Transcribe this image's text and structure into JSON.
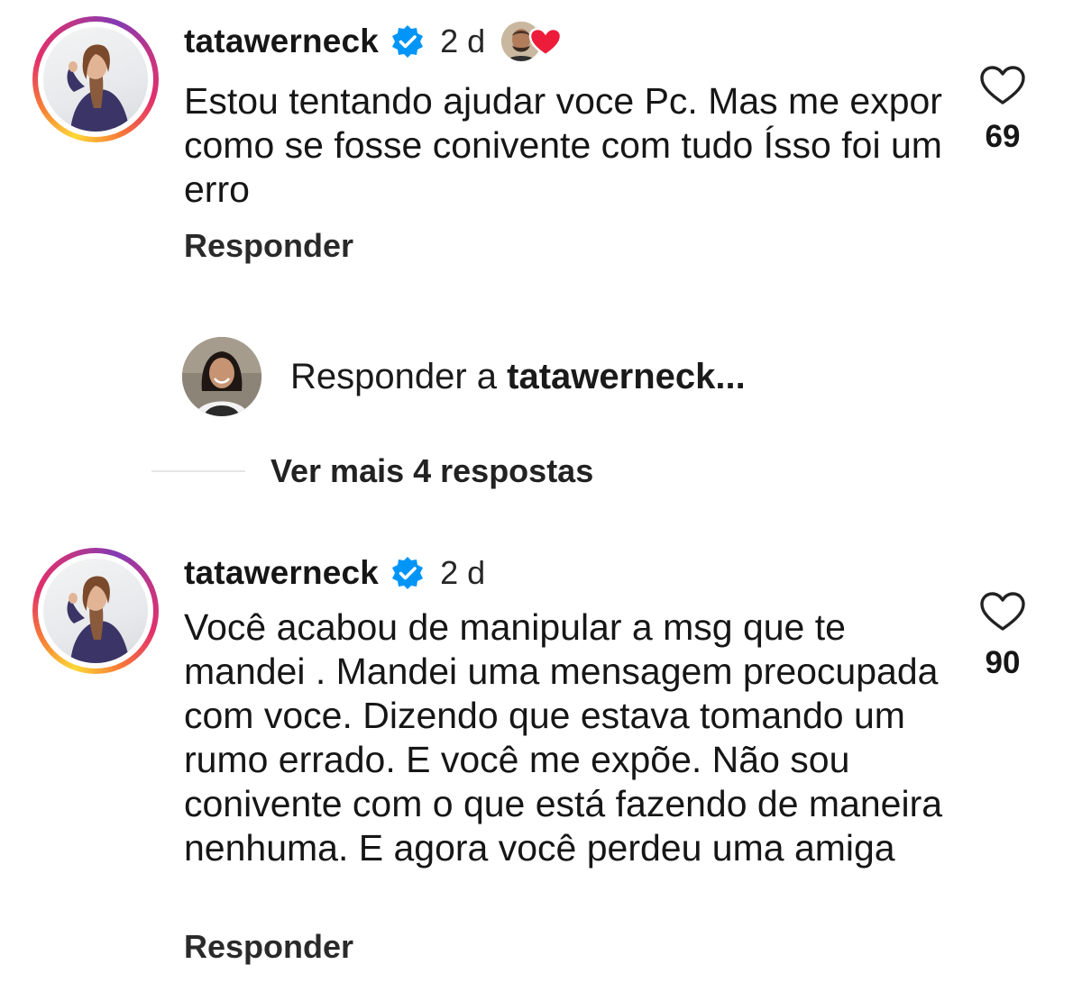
{
  "comments": [
    {
      "username": "tatawerneck",
      "time": "2 d",
      "text": "Estou tentando ajudar voce Pc. Mas me expor como se fosse conivente com tudo Ísso foi um erro",
      "reply_label": "Responder",
      "like_count": "69",
      "liked_by_author": true
    },
    {
      "username": "tatawerneck",
      "time": "2 d",
      "text": "Você acabou de manipular a msg que te mandei . Mandei uma mensagem preocupada com voce. Dizendo que estava tomando um rumo errado. E você me expõe. Não sou conivente com o que está fazendo de maneira nenhuma. E agora você perdeu uma amiga",
      "reply_label": "Responder",
      "like_count": "90",
      "liked_by_author": false
    }
  ],
  "reply_composer": {
    "prefix": "Responder a ",
    "target": "tatawerneck..."
  },
  "more_replies": {
    "label": "Ver mais 4 respostas"
  },
  "icons": {
    "verified": "verified-badge-icon",
    "like": "heart-outline-icon",
    "liked_by_author": "red-heart-icon"
  },
  "colors": {
    "verified_blue": "#0095f6",
    "heart_red": "#ed1c3a",
    "text": "#161616",
    "divider": "#e6e6e6"
  }
}
